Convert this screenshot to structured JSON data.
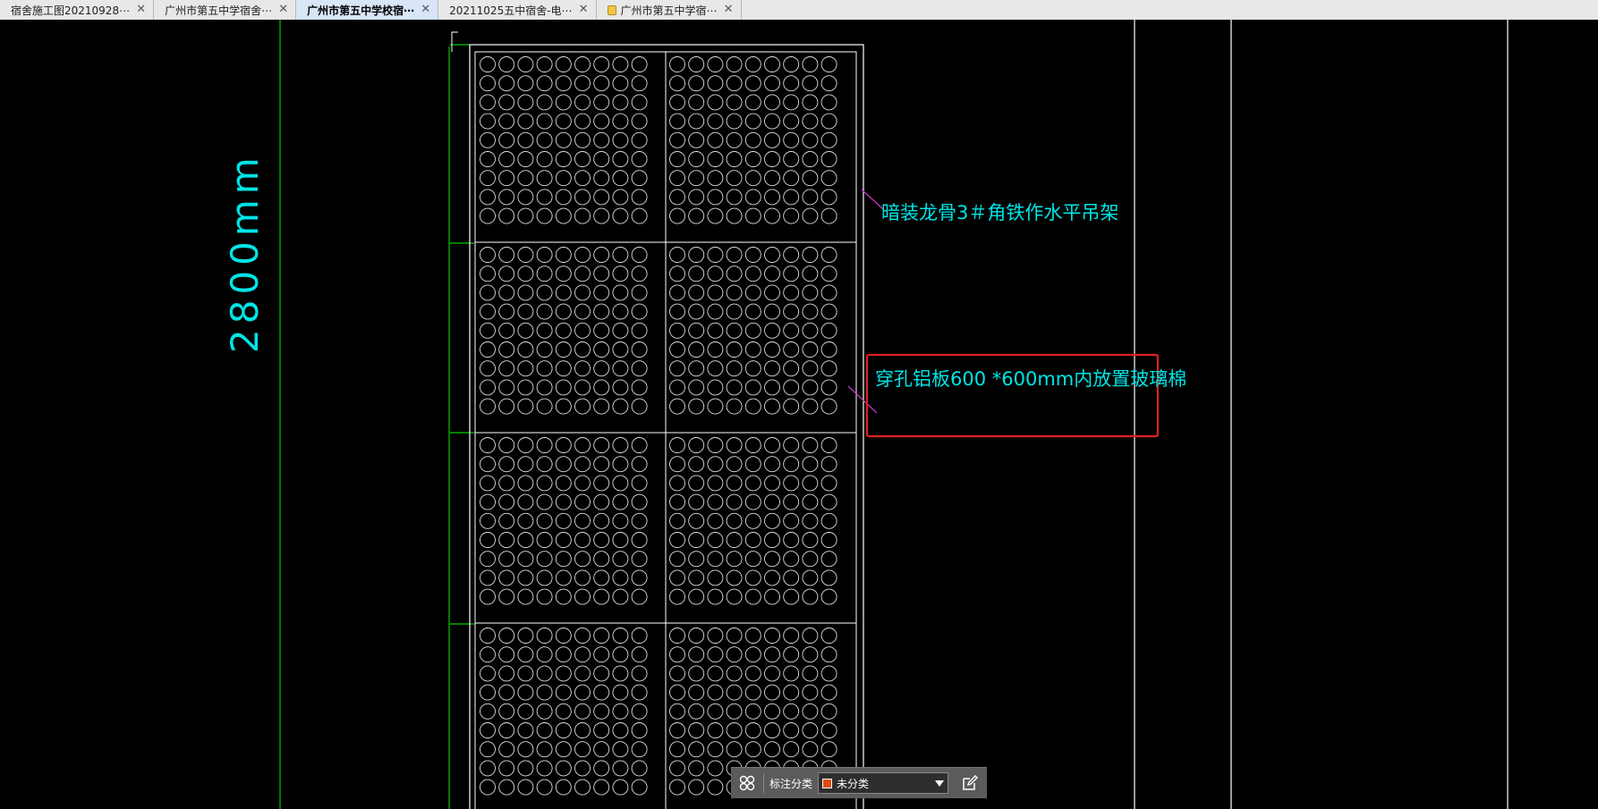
{
  "tabs": [
    {
      "label": "宿舍施工图20210928⋯",
      "active": false,
      "locked": false
    },
    {
      "label": "广州市第五中学宿舍⋯",
      "active": false,
      "locked": false
    },
    {
      "label": "广州市第五中学校宿⋯",
      "active": true,
      "locked": false
    },
    {
      "label": "20211025五中宿舍-电⋯",
      "active": false,
      "locked": false
    },
    {
      "label": "广州市第五中学宿⋯",
      "active": false,
      "locked": true
    }
  ],
  "tab_close_glyph": "✕",
  "drawing": {
    "dimension_text": "2800mm",
    "note_top": "暗装龙骨3＃角铁作水平吊架",
    "note_highlighted": "穿孔铝板600 *600mm内放置玻璃棉",
    "colors": {
      "background": "#000000",
      "lines": "#ffffff",
      "dimension": "#00cc00",
      "text": "#00e5e5",
      "leader": "#cc33cc",
      "highlight_box": "#e02020"
    }
  },
  "annotation_bar": {
    "label": "标注分类",
    "selected": "未分类",
    "swatch_color": "#e04a10",
    "icons": [
      "grid-icon",
      "chevron-down-icon",
      "edit-icon"
    ]
  }
}
